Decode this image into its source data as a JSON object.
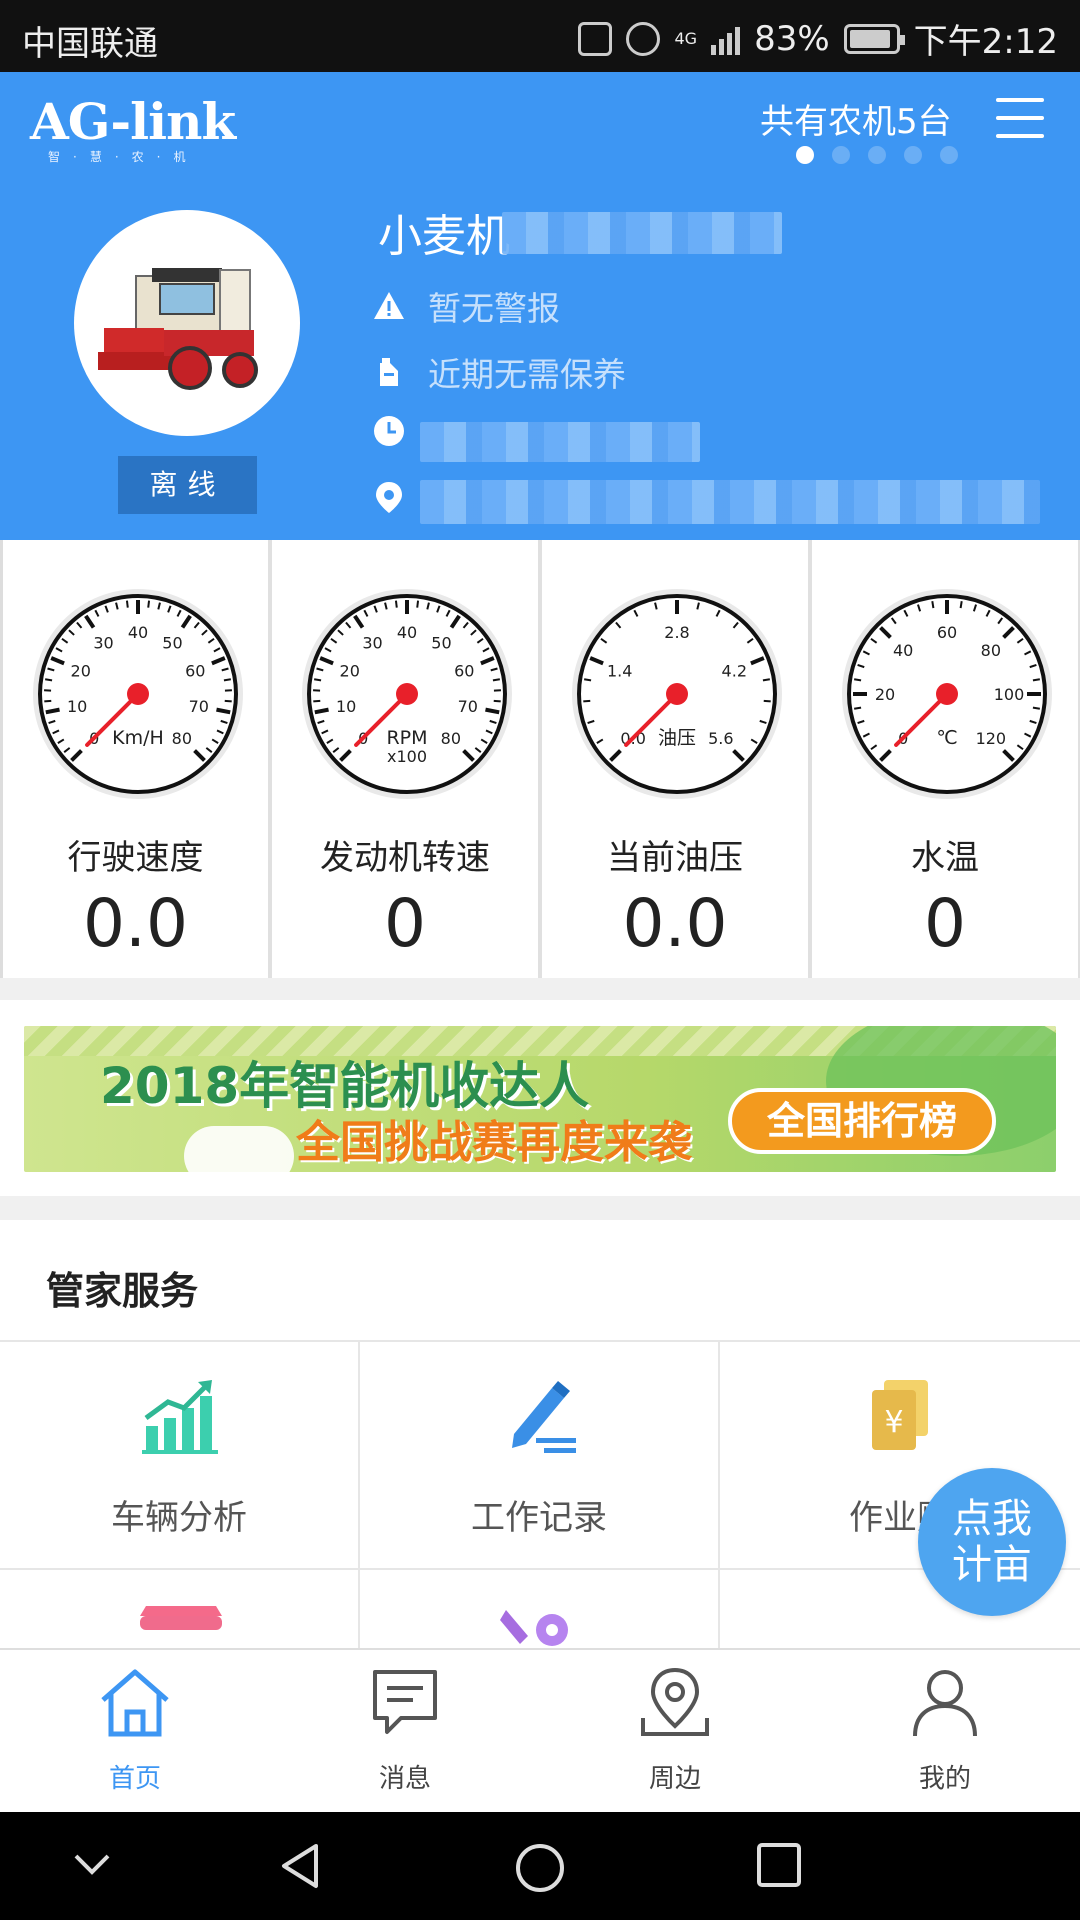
{
  "status_bar": {
    "carrier": "中国联通",
    "network": "4G",
    "battery": "83%",
    "time": "下午2:12"
  },
  "header": {
    "logo": "AG-link",
    "logo_sub": "智·慧·农·机",
    "machine_count": "共有农机5台",
    "page_dots": 5,
    "active_dot": 0,
    "machine_name": "小麦机",
    "status": "离线",
    "alert": "暂无警报",
    "maintenance": "近期无需保养",
    "accent_color": "#3d96f3"
  },
  "gauges": [
    {
      "label": "行驶速度",
      "value": "0.0",
      "unit": "Km/H",
      "unit2": "",
      "ticks": [
        "0",
        "10",
        "20",
        "30",
        "40",
        "50",
        "60",
        "70",
        "80"
      ],
      "reading": 0
    },
    {
      "label": "发动机转速",
      "value": "0",
      "unit": "RPM",
      "unit2": "x100",
      "ticks": [
        "0",
        "10",
        "20",
        "30",
        "40",
        "50",
        "60",
        "70",
        "80"
      ],
      "reading": 0
    },
    {
      "label": "当前油压",
      "value": "0.0",
      "unit": "油压",
      "unit2": "",
      "ticks": [
        "0.0",
        "1.4",
        "2.8",
        "4.2",
        "5.6"
      ],
      "reading": 0
    },
    {
      "label": "水温",
      "value": "0",
      "unit": "℃",
      "unit2": "",
      "ticks": [
        "0",
        "20",
        "40",
        "60",
        "80",
        "100",
        "120"
      ],
      "reading": 0
    }
  ],
  "banner": {
    "line1": "2018年智能机收达人",
    "line2": "全国挑战赛再度来袭",
    "button": "全国排行榜"
  },
  "services": {
    "title": "管家服务",
    "items": [
      {
        "label": "车辆分析",
        "icon": "bar-chart-icon"
      },
      {
        "label": "工作记录",
        "icon": "edit-pen-icon"
      },
      {
        "label": "作业账",
        "icon": "yuan-bill-icon"
      }
    ]
  },
  "fab": {
    "line1": "点我",
    "line2": "计亩"
  },
  "tabs": [
    {
      "label": "首页",
      "icon": "home-icon",
      "active": true
    },
    {
      "label": "消息",
      "icon": "message-icon",
      "active": false
    },
    {
      "label": "周边",
      "icon": "location-icon",
      "active": false
    },
    {
      "label": "我的",
      "icon": "user-icon",
      "active": false
    }
  ]
}
